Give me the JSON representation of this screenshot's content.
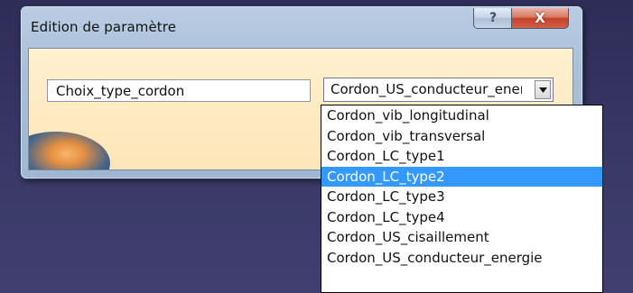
{
  "dialog": {
    "title": "Edition de paramètre",
    "help_label": "?",
    "close_label": "X",
    "parameter_name": "Choix_type_cordon",
    "selected_value": "Cordon_US_conducteur_energie"
  },
  "dropdown": {
    "options": [
      "Cordon_vib_longitudinal",
      "Cordon_vib_transversal",
      "Cordon_LC_type1",
      "Cordon_LC_type2",
      "Cordon_LC_type3",
      "Cordon_LC_type4",
      "Cordon_US_cisaillement",
      "Cordon_US_conducteur_energie"
    ],
    "highlighted_index": 3,
    "highlight_color": "#3399ff"
  }
}
